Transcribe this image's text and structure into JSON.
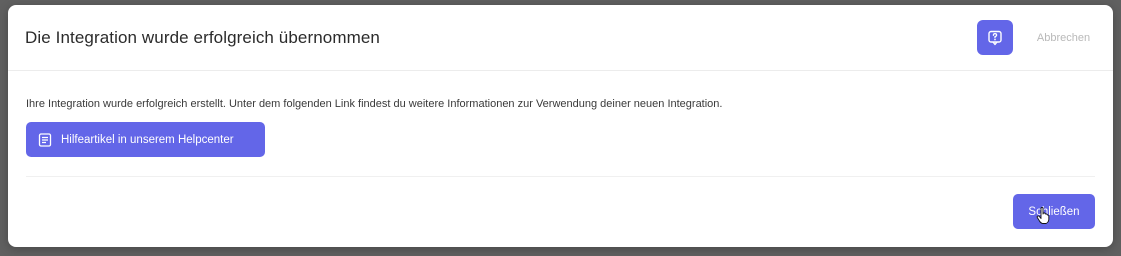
{
  "dialog": {
    "title": "Die Integration wurde erfolgreich übernommen",
    "cancel_label": "Abbrechen",
    "help_icon": "help-chat-icon",
    "body_text": "Ihre Integration wurde erfolgreich erstellt. Unter dem folgenden Link findest du weitere Informationen zur Verwendung deiner neuen Integration.",
    "help_article_label": "Hilfeartikel in unserem Helpcenter",
    "help_article_icon": "document-icon",
    "close_label": "Schließen"
  },
  "colors": {
    "accent": "#6366e8",
    "overlay": "#606060",
    "text": "#2b2b2b",
    "muted": "#b9b9b9"
  }
}
